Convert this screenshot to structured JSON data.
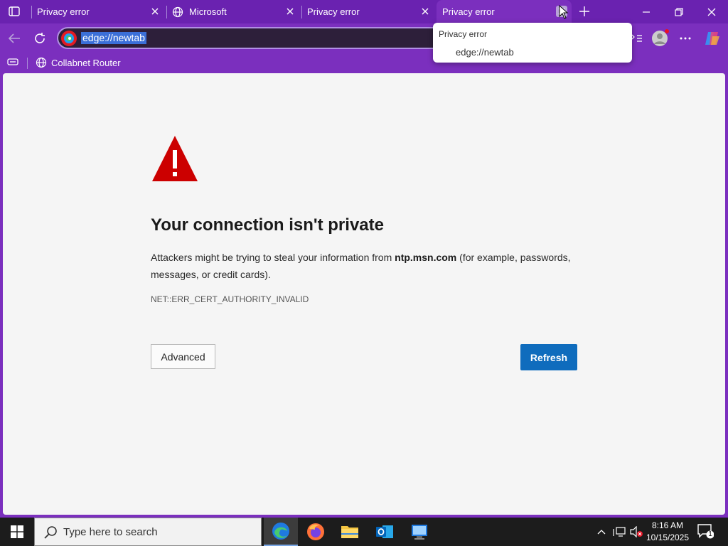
{
  "tabs": [
    {
      "title": "Privacy error",
      "active": false
    },
    {
      "title": "Microsoft",
      "active": false
    },
    {
      "title": "Privacy error",
      "active": false
    },
    {
      "title": "Privacy error",
      "active": true
    }
  ],
  "address_bar": {
    "url": "edge://newtab"
  },
  "favorites": [
    {
      "label": "Collabnet Router"
    }
  ],
  "hover_popup": {
    "title": "Privacy error",
    "url": "edge://newtab"
  },
  "page": {
    "heading": "Your connection isn't private",
    "description_pre": "Attackers might be trying to steal your information from ",
    "domain": "ntp.msn.com",
    "description_post": " (for example, passwords, messages, or credit cards).",
    "error_code": "NET::ERR_CERT_AUTHORITY_INVALID",
    "advanced_label": "Advanced",
    "refresh_label": "Refresh"
  },
  "taskbar": {
    "search_placeholder": "Type here to search",
    "apps": [
      "edge-icon",
      "firefox-icon",
      "file-explorer-icon",
      "outlook-icon",
      "remote-desktop-icon"
    ],
    "time": "8:16 AM",
    "date": "10/15/2025",
    "notification_count": "1"
  },
  "colors": {
    "accent": "#7b2fbe",
    "refresh_button": "#0f6cbd",
    "warning": "#cc0000"
  }
}
